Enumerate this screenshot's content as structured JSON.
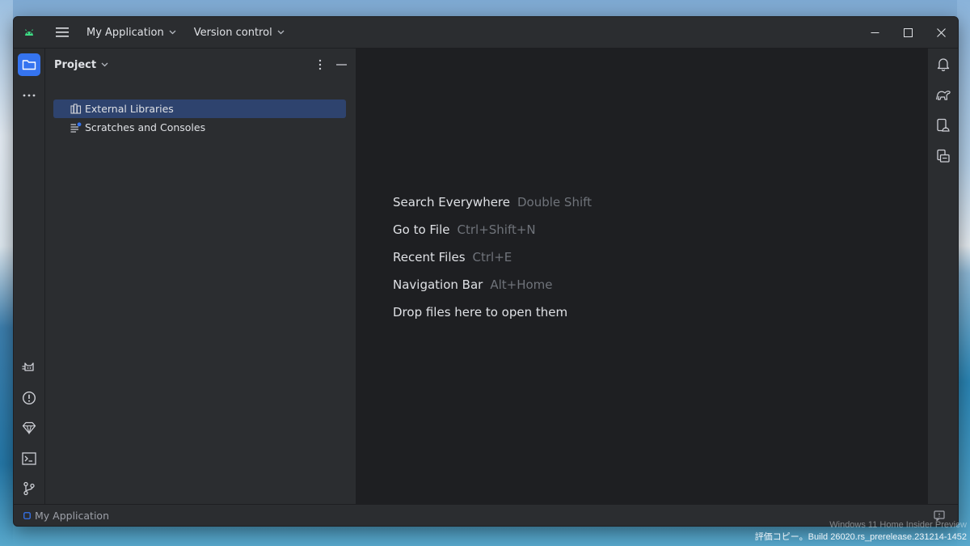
{
  "titlebar": {
    "project_menu": "My Application",
    "vcs_menu": "Version control"
  },
  "project_panel": {
    "title": "Project",
    "tree": [
      {
        "label": "External Libraries",
        "icon": "library-icon",
        "selected": true
      },
      {
        "label": "Scratches and Consoles",
        "icon": "scratches-icon",
        "selected": false
      }
    ]
  },
  "editor_hints": [
    {
      "action": "Search Everywhere",
      "shortcut": "Double Shift"
    },
    {
      "action": "Go to File",
      "shortcut": "Ctrl+Shift+N"
    },
    {
      "action": "Recent Files",
      "shortcut": "Ctrl+E"
    },
    {
      "action": "Navigation Bar",
      "shortcut": "Alt+Home"
    },
    {
      "action": "Drop files here to open them",
      "shortcut": ""
    }
  ],
  "statusbar": {
    "project_name": "My Application"
  },
  "desktop": {
    "watermark_line1": "Windows 11 Home Insider Preview",
    "watermark_line2": "評価コピー。Build 26020.rs_prerelease.231214-1452"
  },
  "colors": {
    "accent": "#3574f0",
    "selection": "#2e436e",
    "editor_bg": "#1e1f22",
    "panel_bg": "#2b2d30",
    "android_green": "#3ddc84"
  }
}
